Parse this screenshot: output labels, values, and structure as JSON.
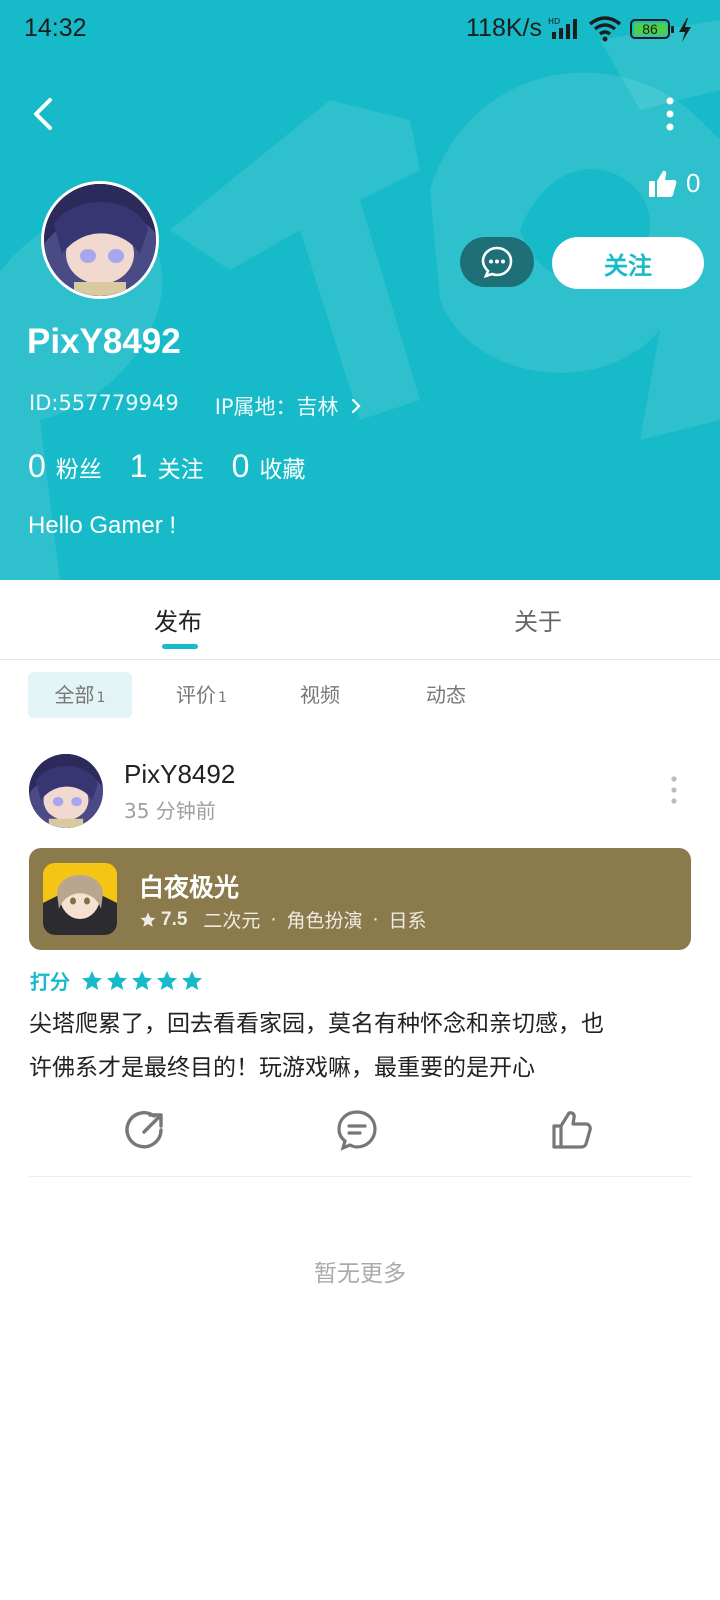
{
  "status_bar": {
    "time": "14:32",
    "network_speed": "118K/s",
    "signal_label": "HD",
    "battery": "86",
    "icons": [
      "signal-icon",
      "wifi-icon",
      "battery-icon",
      "charging-icon"
    ]
  },
  "colors": {
    "brand": "#17BAC8",
    "game_card": "#8A7A4C",
    "message_button": "#1f6f76"
  },
  "profile": {
    "likes": "0",
    "username": "PixY8492",
    "id": "ID:557779949",
    "ip_location": "IP属地：吉林",
    "stats": [
      {
        "num": "0",
        "label": "粉丝"
      },
      {
        "num": "1",
        "label": "关注"
      },
      {
        "num": "0",
        "label": "收藏"
      }
    ],
    "bio": "Hello Gamer !",
    "follow_label": "关注"
  },
  "tabs": [
    {
      "label": "发布",
      "active": true
    },
    {
      "label": "关于",
      "active": false
    }
  ],
  "filters": [
    {
      "label": "全部",
      "count": "1",
      "active": true
    },
    {
      "label": "评价",
      "count": "1",
      "active": false
    },
    {
      "label": "视频",
      "count": "",
      "active": false
    },
    {
      "label": "动态",
      "count": "",
      "active": false
    }
  ],
  "post": {
    "username": "PixY8492",
    "time": "35 分钟前",
    "game": {
      "title": "白夜极光",
      "rating": "7.5",
      "tags": [
        "二次元",
        "角色扮演",
        "日系"
      ]
    },
    "score_label": "打分",
    "stars": 5,
    "text_line1": "尖塔爬累了，回去看看家园，莫名有种怀念和亲切感，也",
    "text_line2": "许佛系才是最终目的！玩游戏嘛，最重要的是开心"
  },
  "footer": {
    "no_more": "暂无更多"
  }
}
